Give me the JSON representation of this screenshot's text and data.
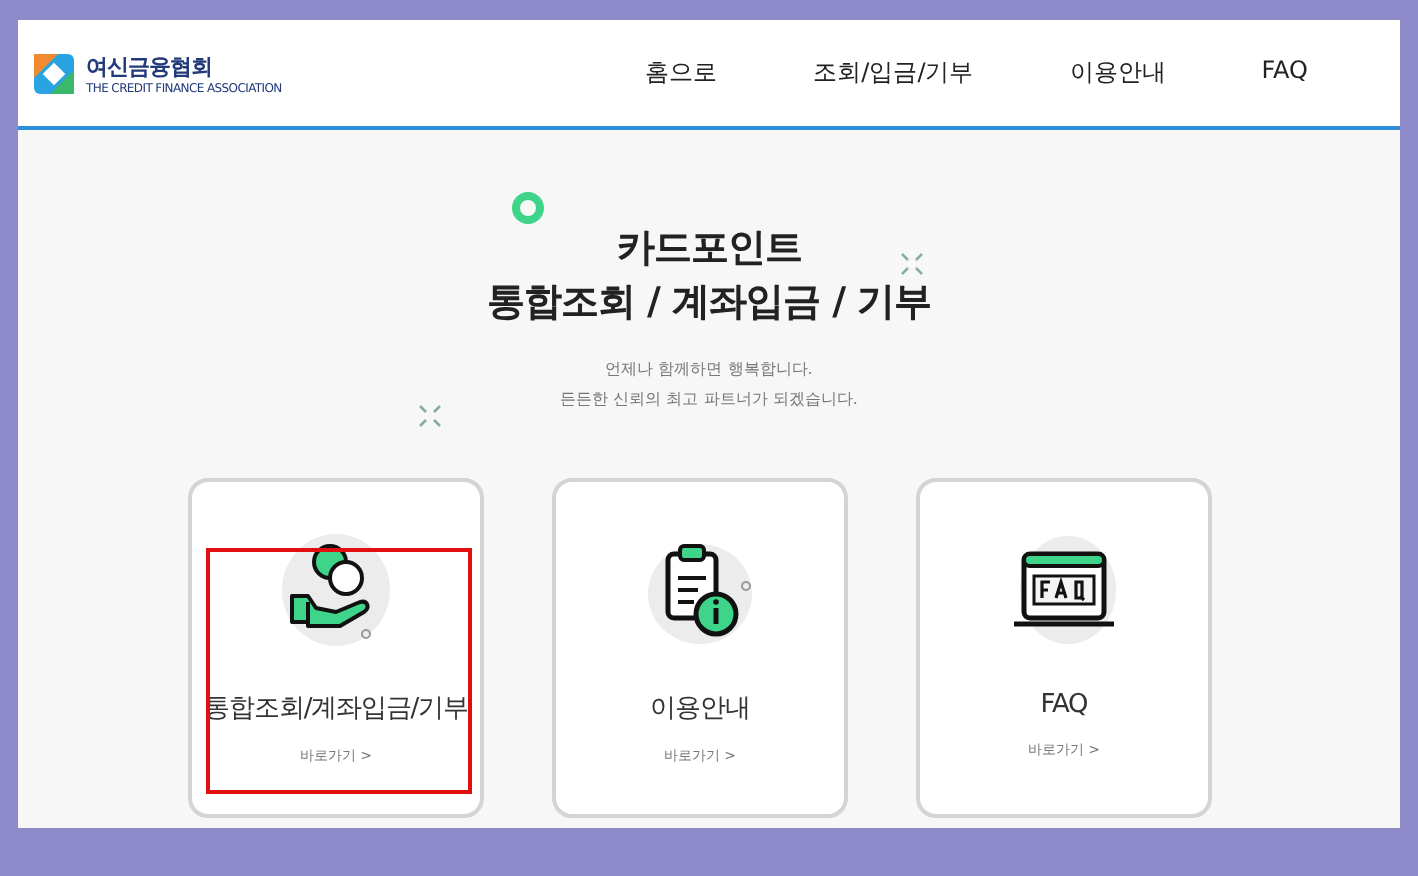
{
  "header": {
    "logo": {
      "name": "여신금융협회",
      "subtitle": "THE CREDIT FINANCE ASSOCIATION"
    },
    "nav": [
      {
        "label": "홈으로"
      },
      {
        "label": "조회/입금/기부"
      },
      {
        "label": "이용안내"
      },
      {
        "label": "FAQ"
      }
    ]
  },
  "hero": {
    "title_lines": [
      "카드포인트",
      "통합조회 / 계좌입금 / 기부"
    ],
    "subtitle_lines": [
      "언제나 함께하면 행복합니다.",
      "든든한 신뢰의 최고 파트너가 되겠습니다."
    ]
  },
  "cards": [
    {
      "kind": "coin",
      "title": "통합조회/계좌입금/기부",
      "link": "바로가기 >",
      "highlighted": true
    },
    {
      "kind": "clipboard",
      "title": "이용안내",
      "link": "바로가기 >",
      "highlighted": false
    },
    {
      "kind": "faq",
      "title": "FAQ",
      "link": "바로가기 >",
      "highlighted": false
    }
  ]
}
